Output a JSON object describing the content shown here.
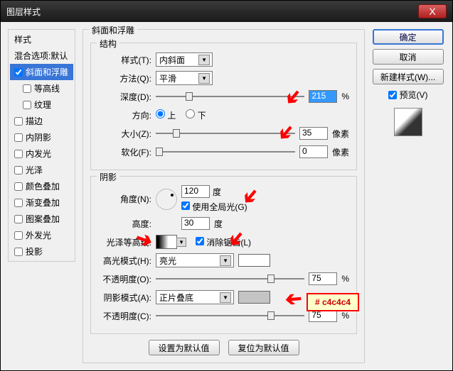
{
  "window": {
    "title": "图层样式",
    "close": "X"
  },
  "sidebar": {
    "header": "样式",
    "blend": "混合选项:默认",
    "bevel": "斜面和浮雕",
    "contour": "等高线",
    "texture": "纹理",
    "stroke": "描边",
    "innerShadow": "内阴影",
    "innerGlow": "内发光",
    "satin": "光泽",
    "colorOverlay": "颜色叠加",
    "gradOverlay": "渐变叠加",
    "patOverlay": "图案叠加",
    "outerGlow": "外发光",
    "dropShadow": "投影"
  },
  "structure": {
    "sectionTitle": "斜面和浮雕",
    "group": "结构",
    "styleLbl": "样式(T):",
    "style": "内斜面",
    "methodLbl": "方法(Q):",
    "method": "平滑",
    "depthLbl": "深度(D):",
    "depth": "215",
    "depthUnit": "%",
    "dirLbl": "方向:",
    "up": "上",
    "down": "下",
    "sizeLbl": "大小(Z):",
    "size": "35",
    "sizeUnit": "像素",
    "softenLbl": "软化(F):",
    "soften": "0",
    "softenUnit": "像素"
  },
  "shading": {
    "group": "阴影",
    "angleLbl": "角度(N):",
    "angle": "120",
    "angleUnit": "度",
    "globalLight": "使用全局光(G)",
    "altitudeLbl": "高度:",
    "altitude": "30",
    "altUnit": "度",
    "glossLbl": "光泽等高线:",
    "antialias": "消除锯齿(L)",
    "hlModeLbl": "高光模式(H):",
    "hlMode": "亮光",
    "hlOpacityLbl": "不透明度(O):",
    "hlOpacity": "75",
    "pct": "%",
    "shModeLbl": "阴影模式(A):",
    "shMode": "正片叠底",
    "shOpacityLbl": "不透明度(C):",
    "shOpacity": "75"
  },
  "buttons": {
    "ok": "确定",
    "cancel": "取消",
    "newStyle": "新建样式(W)...",
    "preview": "预览(V)",
    "makeDefault": "设置为默认值",
    "resetDefault": "复位为默认值"
  },
  "annotation": {
    "colorHex": "# c4c4c4"
  },
  "colors": {
    "shadowSwatch": "#c4c4c4",
    "hlSwatch": "#ffffff"
  }
}
